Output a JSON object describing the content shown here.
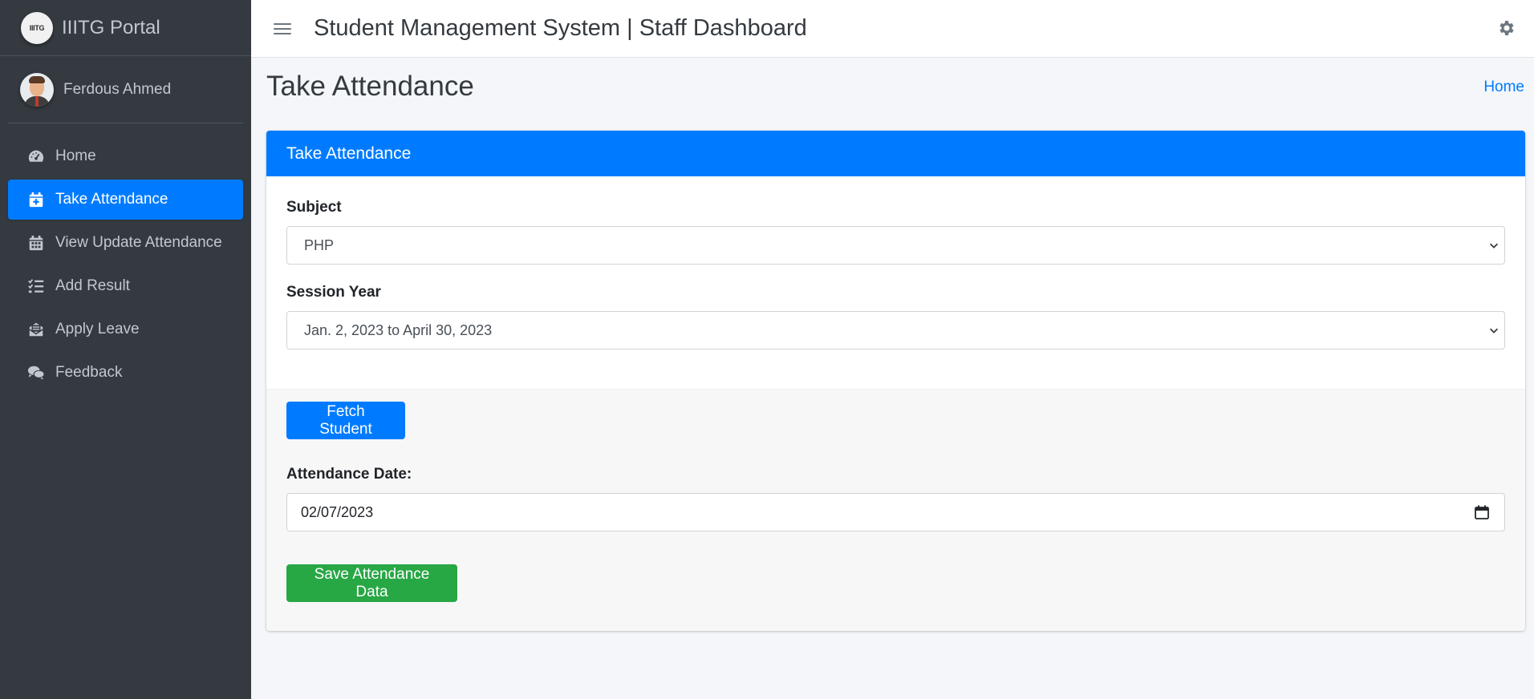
{
  "brand": {
    "logo_text": "IIITG",
    "name": "IIITG Portal"
  },
  "user": {
    "name": "Ferdous Ahmed"
  },
  "sidebar": {
    "items": [
      {
        "label": "Home",
        "icon": "tachometer-icon",
        "active": false
      },
      {
        "label": "Take Attendance",
        "icon": "calendar-plus-icon",
        "active": true
      },
      {
        "label": "View Update Attendance",
        "icon": "calendar-icon",
        "active": false
      },
      {
        "label": "Add Result",
        "icon": "tasks-icon",
        "active": false
      },
      {
        "label": "Apply Leave",
        "icon": "envelope-open-icon",
        "active": false
      },
      {
        "label": "Feedback",
        "icon": "comments-icon",
        "active": false
      }
    ]
  },
  "navbar": {
    "title": "Student Management System | Staff Dashboard"
  },
  "page": {
    "title": "Take Attendance",
    "breadcrumb": "Home"
  },
  "card": {
    "header": "Take Attendance",
    "subject": {
      "label": "Subject",
      "value": "PHP"
    },
    "session_year": {
      "label": "Session Year",
      "value": "Jan. 2, 2023 to April 30, 2023"
    },
    "fetch_button": "Fetch Student",
    "attendance_date": {
      "label": "Attendance Date:",
      "value": "02/07/2023"
    },
    "save_button": "Save Attendance Data"
  },
  "colors": {
    "primary": "#007bff",
    "success": "#28a745",
    "sidebar": "#343a40"
  }
}
